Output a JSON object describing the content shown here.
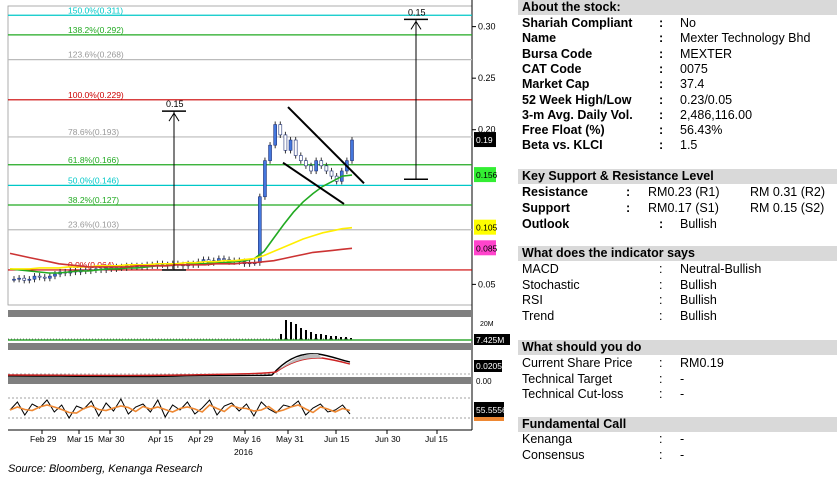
{
  "chart_data": {
    "type": "line",
    "source": "Source: Bloomberg, Kenanga Research",
    "x_tick_labels": [
      "Feb 29",
      "Mar 15",
      "Mar 30",
      "Apr 15",
      "Apr 29",
      "May 16",
      "May 31",
      "Jun 15",
      "Jun 30",
      "Jul 15"
    ],
    "x_year_label": "2016",
    "y_ticks": [
      "0.30",
      "0.25",
      "0.20",
      "0.05"
    ],
    "ylim": [
      0.03,
      0.32
    ],
    "fib_levels": [
      {
        "label": "150.0%(0.311)",
        "value": 0.311,
        "color": "#00c8c8"
      },
      {
        "label": "138.2%(0.292)",
        "value": 0.292,
        "color": "#22aa22"
      },
      {
        "label": "123.6%(0.268)",
        "value": 0.268,
        "color": "#bbbbbb"
      },
      {
        "label": "100.0%(0.229)",
        "value": 0.229,
        "color": "#cc0000"
      },
      {
        "label": "78.6%(0.193)",
        "value": 0.193,
        "color": "#bbbbbb"
      },
      {
        "label": "61.8%(0.166)",
        "value": 0.166,
        "color": "#22aa22"
      },
      {
        "label": "50.0%(0.146)",
        "value": 0.146,
        "color": "#00c8c8"
      },
      {
        "label": "38.2%(0.127)",
        "value": 0.127,
        "color": "#22aa22"
      },
      {
        "label": "23.6%(0.103)",
        "value": 0.103,
        "color": "#bbbbbb"
      },
      {
        "label": "0.0%(0.064)",
        "value": 0.064,
        "color": "#cc0000"
      }
    ],
    "annotations": [
      "0.15",
      "0.15"
    ],
    "price_tags": [
      {
        "label": "0.19",
        "value": 0.19,
        "bg": "#000000",
        "fg": "#ffffff"
      },
      {
        "label": "0.156",
        "value": 0.156,
        "bg": "#33ee33",
        "fg": "#000000"
      },
      {
        "label": "0.105",
        "value": 0.105,
        "bg": "#ffff00",
        "fg": "#000000"
      },
      {
        "label": "0.085",
        "value": 0.085,
        "bg": "#ff44cc",
        "fg": "#000000"
      }
    ],
    "close": [
      0.055,
      0.056,
      0.054,
      0.055,
      0.058,
      0.057,
      0.056,
      0.058,
      0.06,
      0.062,
      0.061,
      0.063,
      0.062,
      0.064,
      0.063,
      0.064,
      0.065,
      0.064,
      0.066,
      0.065,
      0.067,
      0.066,
      0.068,
      0.067,
      0.068,
      0.067,
      0.069,
      0.068,
      0.07,
      0.069,
      0.068,
      0.07,
      0.069,
      0.068,
      0.07,
      0.069,
      0.072,
      0.074,
      0.071,
      0.073,
      0.075,
      0.074,
      0.072,
      0.073,
      0.072,
      0.07,
      0.071,
      0.071,
      0.135,
      0.17,
      0.185,
      0.205,
      0.195,
      0.18,
      0.19,
      0.175,
      0.17,
      0.165,
      0.16,
      0.17,
      0.165,
      0.16,
      0.155,
      0.15,
      0.16,
      0.17,
      0.19
    ],
    "ma_lines": [
      {
        "name": "",
        "color": "#22aa22",
        "values": [
          0.065,
          0.064,
          0.063,
          0.062,
          0.061,
          0.061,
          0.062,
          0.063,
          0.063,
          0.064,
          0.065,
          0.065,
          0.066,
          0.066,
          0.067,
          0.068,
          0.068,
          0.069,
          0.069,
          0.07,
          0.07,
          0.071,
          0.071,
          0.072,
          0.073,
          0.075,
          0.082,
          0.095,
          0.108,
          0.12,
          0.13,
          0.138,
          0.145,
          0.15,
          0.155,
          0.156
        ]
      },
      {
        "name": "",
        "color": "#ffee00",
        "values": [
          0.065,
          0.065,
          0.065,
          0.066,
          0.066,
          0.066,
          0.067,
          0.067,
          0.067,
          0.068,
          0.068,
          0.068,
          0.069,
          0.069,
          0.069,
          0.07,
          0.07,
          0.07,
          0.071,
          0.071,
          0.072,
          0.072,
          0.073,
          0.073,
          0.074,
          0.075,
          0.078,
          0.082,
          0.086,
          0.09,
          0.094,
          0.097,
          0.1,
          0.102,
          0.104,
          0.105
        ]
      },
      {
        "name": "",
        "color": "#cc3333",
        "values": [
          0.08,
          0.078,
          0.076,
          0.074,
          0.072,
          0.07,
          0.069,
          0.068,
          0.067,
          0.067,
          0.067,
          0.067,
          0.067,
          0.068,
          0.068,
          0.068,
          0.068,
          0.069,
          0.069,
          0.069,
          0.069,
          0.07,
          0.07,
          0.07,
          0.071,
          0.071,
          0.072,
          0.073,
          0.075,
          0.077,
          0.079,
          0.081,
          0.082,
          0.083,
          0.084,
          0.085
        ]
      }
    ],
    "volume_tag": "7.425M",
    "macd_tag": "0.0205",
    "macd_zero": "0.00",
    "stoch_tag": "55.5556",
    "volume_axis": "20M"
  },
  "panel": {
    "about_title": "About the stock:",
    "about_rows": [
      {
        "label": "Shariah Compliant",
        "value": "No"
      },
      {
        "label": "Name",
        "value": "Mexter Technology Bhd"
      },
      {
        "label": "Bursa Code",
        "value": "MEXTER"
      },
      {
        "label": "CAT Code",
        "value": "0075"
      },
      {
        "label": "Market Cap",
        "value": "37.4"
      },
      {
        "label": "52 Week High/Low",
        "value": "0.23/0.05"
      },
      {
        "label": "3-m Avg. Daily Vol.",
        "value": "2,486,116.00"
      },
      {
        "label": "Free Float (%)",
        "value": "56.43%"
      },
      {
        "label": "Beta vs. KLCI",
        "value": "1.5"
      }
    ],
    "sr_title": "Key Support & Resistance Level",
    "resistance": {
      "label": "Resistance",
      "v1": "RM0.23 (R1)",
      "v2": "RM 0.31 (R2)"
    },
    "support": {
      "label": "Support",
      "v1": "RM0.17 (S1)",
      "v2": "RM 0.15 (S2)"
    },
    "outlook": {
      "label": "Outlook",
      "value": "Bullish"
    },
    "ind_title": "What does the indicator says",
    "ind_rows": [
      {
        "label": "MACD",
        "value": "Neutral-Bullish"
      },
      {
        "label": "Stochastic",
        "value": "Bullish"
      },
      {
        "label": "RSI",
        "value": "Bullish"
      },
      {
        "label": "Trend",
        "value": "Bullish"
      }
    ],
    "do_title": "What should you do",
    "do_rows": [
      {
        "label": "Current Share Price",
        "value": "RM0.19"
      },
      {
        "label": "Technical Target",
        "value": "-"
      },
      {
        "label": "Technical Cut-loss",
        "value": "-"
      }
    ],
    "fund_title": "Fundamental Call",
    "fund_rows": [
      {
        "label": "Kenanga",
        "value": "-"
      },
      {
        "label": "Consensus",
        "value": "-"
      }
    ],
    "colon": ":"
  }
}
